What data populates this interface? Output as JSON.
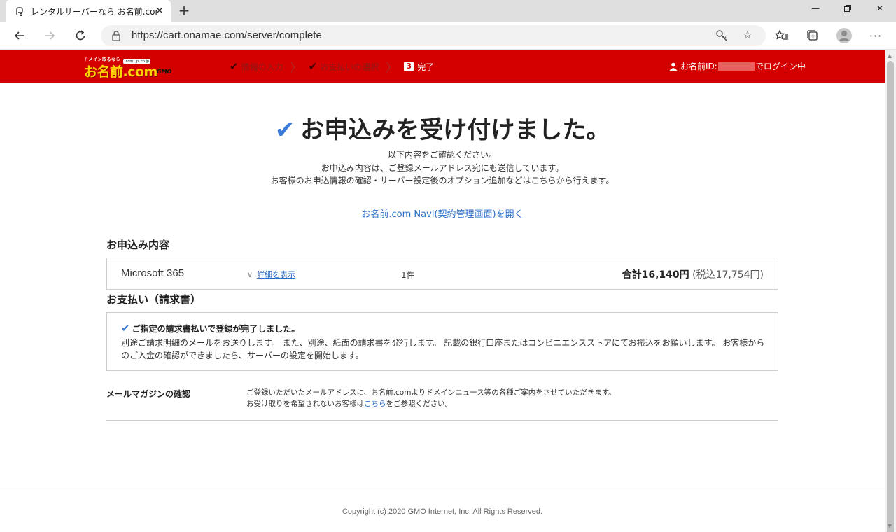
{
  "browser": {
    "tab_title": "レンタルサーバーなら お名前.com",
    "url": "https://cart.onamae.com/server/complete",
    "icons": [
      "back-arrow-icon",
      "forward-arrow-icon",
      "refresh-icon",
      "lock-icon",
      "key-icon",
      "star-icon",
      "favorites-icon",
      "collections-icon",
      "profile-icon",
      "more-icon"
    ]
  },
  "site_header": {
    "logo_tagline": "ドメイン取るなら",
    "logo_text": "お名前.com",
    "logo_domains": ".com .jp .co.jp",
    "logo_brand": "GMO",
    "steps": [
      {
        "label": "情報の入力",
        "state": "done"
      },
      {
        "label": "お支払いの選択",
        "state": "done"
      },
      {
        "number": "3",
        "label": "完了",
        "state": "active"
      }
    ],
    "login_prefix": "お名前ID:",
    "login_suffix": "でログイン中",
    "color": "#d40000"
  },
  "main": {
    "heading": "お申込みを受け付けました。",
    "intro_lines": [
      "以下内容をご確認ください。",
      "お申込み内容は、ご登録メールアドレス宛にも送信しています。",
      "お客様のお申込情報の確認・サーバー設定後のオプション追加などはこちらから行えます。"
    ],
    "navi_link": "お名前.com Navi(契約管理画面)を開く",
    "order": {
      "title": "お申込み内容",
      "product": "Microsoft 365",
      "details_link": "詳細を表示",
      "quantity": "1件",
      "total_label": "合計16,140円",
      "total_tax": "(税込17,754円)"
    },
    "payment": {
      "title": "お支払い（請求書）",
      "message": "ご指定の請求書払いで登録が完了しました。",
      "description": "別途ご請求明細のメールをお送りします。 また、別途、紙面の請求書を発行します。 記載の銀行口座またはコンビニエンスストアにてお振込をお願いします。 お客様からのご入金の確認ができましたら、サーバーの設定を開始します。"
    },
    "mail_magazine": {
      "label": "メールマガジンの確認",
      "line1": "ご登録いただいたメールアドレスに、お名前.comよりドメインニュース等の各種ご案内をさせていただきます。",
      "line2_prefix": "お受け取りを希望されないお客様は",
      "line2_link": "こちら",
      "line2_suffix": "をご参照ください。"
    }
  },
  "footer": {
    "copyright": "Copyright (c) 2020 GMO Internet, Inc. All Rights Reserved."
  },
  "colors": {
    "brand_red": "#d40000",
    "link_blue": "#2a6fc9",
    "check_blue": "#3d7cdb"
  }
}
